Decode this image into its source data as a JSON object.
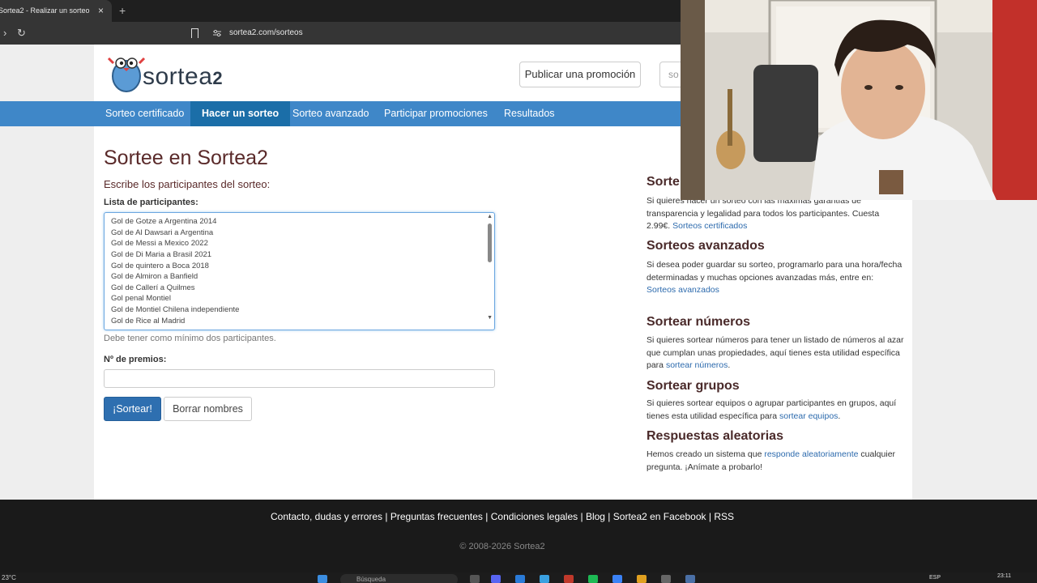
{
  "browser": {
    "tab_title": "Sortea2 - Realizar un sorteo",
    "tab_close": "×",
    "new_tab": "+",
    "url": "sortea2.com/sorteos"
  },
  "header": {
    "logo_text": "sortea",
    "logo_text_num": "2",
    "publish_button": "Publicar una promoción",
    "search_button": "so"
  },
  "nav": {
    "items": [
      "Sorteo certificado",
      "Hacer un sorteo",
      "Sorteo avanzado",
      "Participar promociones",
      "Resultados"
    ]
  },
  "main": {
    "title": "Sortee en Sortea2",
    "subtitle": "Escribe los participantes del sorteo:",
    "participants_label": "Lista de participantes:",
    "participants": [
      "Gol de Gotze a Argentina 2014",
      "Gol de Al Dawsari a Argentina",
      "Gol de Messi a Mexico 2022",
      "Gol de Di Maria a Brasil 2021",
      "Gol de quintero a Boca 2018",
      "Gol de Almiron a Banfield",
      "Gol de Callerí a Quilmes",
      "Gol penal Montiel",
      "Gol de Montiel Chilena independiente",
      "Gol de Rice al Madrid"
    ],
    "min_hint": "Debe tener como mínimo dos participantes.",
    "prizes_label": "Nº de premios:",
    "draw_button": "¡Sortear!",
    "clear_button": "Borrar nombres"
  },
  "sidebar": {
    "certified_title": "Sorte",
    "certified_text": "Si quieres hacer un sorteo con las máximas garantías de transparencia y legalidad para todos los participantes. Cuesta 2.99€.",
    "certified_link": "Sorteos certificados",
    "advanced_title": "Sorteos avanzados",
    "advanced_text": "Si desea poder guardar su sorteo, programarlo para una hora/fecha determinadas y muchas opciones avanzadas más, entre en:",
    "advanced_link": "Sorteos avanzados",
    "numbers_title": "Sortear números",
    "numbers_text": "Si quieres sortear números para tener un listado de números al azar que cumplan unas propiedades, aquí tienes esta utilidad específica para",
    "numbers_link": "sortear números",
    "groups_title": "Sortear grupos",
    "groups_text": "Si quieres sortear equipos o agrupar participantes en grupos, aquí tienes esta utilidad específica para",
    "groups_link": "sortear equipos",
    "random_title": "Respuestas aleatorias",
    "random_text_1": "Hemos creado un sistema que",
    "random_link": "responde aleatoriamente",
    "random_text_2": "cualquier pregunta. ¡Anímate a probarlo!"
  },
  "footer": {
    "links": [
      "Contacto, dudas y errores",
      "Preguntas frecuentes",
      "Condiciones legales",
      "Blog",
      "Sortea2 en Facebook",
      "RSS"
    ],
    "copyright": "© 2008-2026 Sortea2"
  },
  "taskbar": {
    "temperature": "23°C",
    "search": "Búsqueda",
    "language": "ESP",
    "time": "23:11"
  }
}
